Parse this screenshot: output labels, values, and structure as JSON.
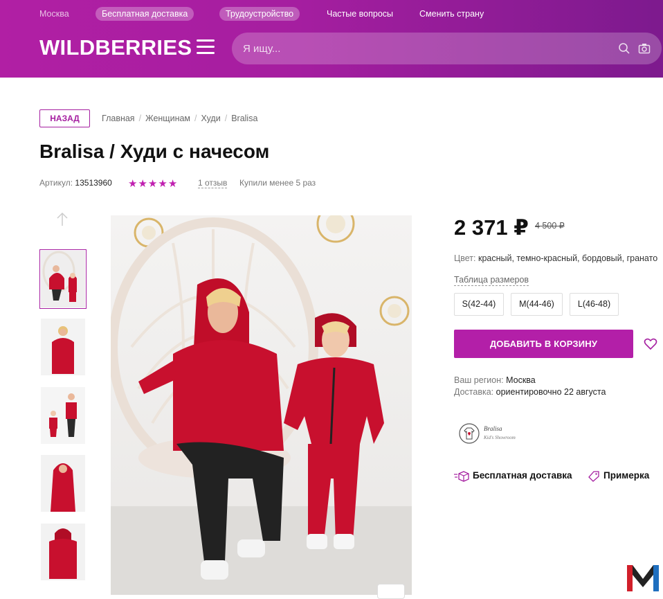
{
  "header": {
    "top_links": [
      "Москва",
      "Бесплатная доставка",
      "Трудоустройство",
      "Частые вопросы",
      "Сменить страну"
    ],
    "logo": "WILDBERRIES",
    "search_placeholder": "Я ищу..."
  },
  "breadcrumb": {
    "back_label": "НАЗАД",
    "items": [
      "Главная",
      "Женщинам",
      "Худи",
      "Bralisa"
    ]
  },
  "product": {
    "title": "Bralisa / Худи с начесом",
    "article_label": "Артикул:",
    "article": "13513960",
    "rating_stars": 5,
    "reviews": "1 отзыв",
    "bought": "Купили менее 5 раз"
  },
  "gallery": {
    "thumb_count": 5,
    "active_index": 0
  },
  "purchase": {
    "price": "2 371 ₽",
    "old_price": "4 500 ₽",
    "color_label": "Цвет:",
    "color_value": "красный, темно-красный, бордовый, гранато",
    "size_table_label": "Таблица размеров",
    "sizes": [
      "S(42-44)",
      "M(44-46)",
      "L(46-48)"
    ],
    "cart_button": "ДОБАВИТЬ В КОРЗИНУ",
    "region_label": "Ваш регион:",
    "region_value": "Москва",
    "delivery_label": "Доставка:",
    "delivery_value": "ориентировочно 22 августа",
    "brand_logo_text": "Bralisa",
    "brand_logo_sub": "Kid's Showroom",
    "features": [
      "Бесплатная доставка",
      "Примерка"
    ]
  },
  "colors": {
    "brand": "#a51ea0",
    "button": "#b31fa8",
    "stars": "#c020b0",
    "hoodie_red": "#c8102e"
  }
}
